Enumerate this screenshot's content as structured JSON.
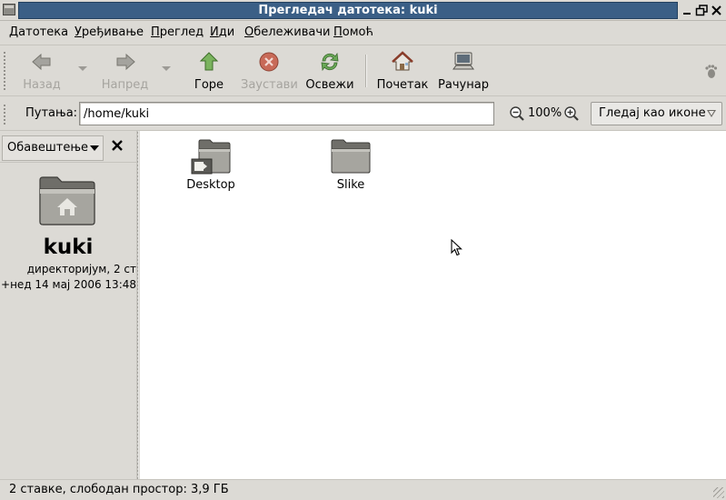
{
  "window": {
    "title": "Прегледач датотека: kuki"
  },
  "menubar": {
    "items": [
      {
        "mnemonic": "Д",
        "rest": "атотека"
      },
      {
        "mnemonic": "У",
        "rest": "ређивање"
      },
      {
        "mnemonic": "П",
        "rest": "реглед"
      },
      {
        "mnemonic": "И",
        "rest": "ди"
      },
      {
        "mnemonic": "О",
        "rest": "бележивачи"
      },
      {
        "mnemonic": "П",
        "rest": "омоћ"
      }
    ]
  },
  "toolbar": {
    "back": "Назад",
    "forward": "Напред",
    "up": "Горе",
    "stop": "Заустави",
    "reload": "Освежи",
    "home": "Почетак",
    "computer": "Рачунар"
  },
  "location": {
    "label": "Путања:",
    "path": "/home/kuki",
    "zoom": "100%",
    "view_mode": "Гледај као иконе"
  },
  "sidepane": {
    "selector": "Обавештење",
    "name": "kuki",
    "description": "директоријум, 2 ст",
    "modified": "+нед 14 мај 2006 13:48"
  },
  "files": [
    {
      "name": "Desktop"
    },
    {
      "name": "Slike"
    }
  ],
  "status": {
    "text": "2 ставке, слободан простор: 3,9 ГБ"
  }
}
